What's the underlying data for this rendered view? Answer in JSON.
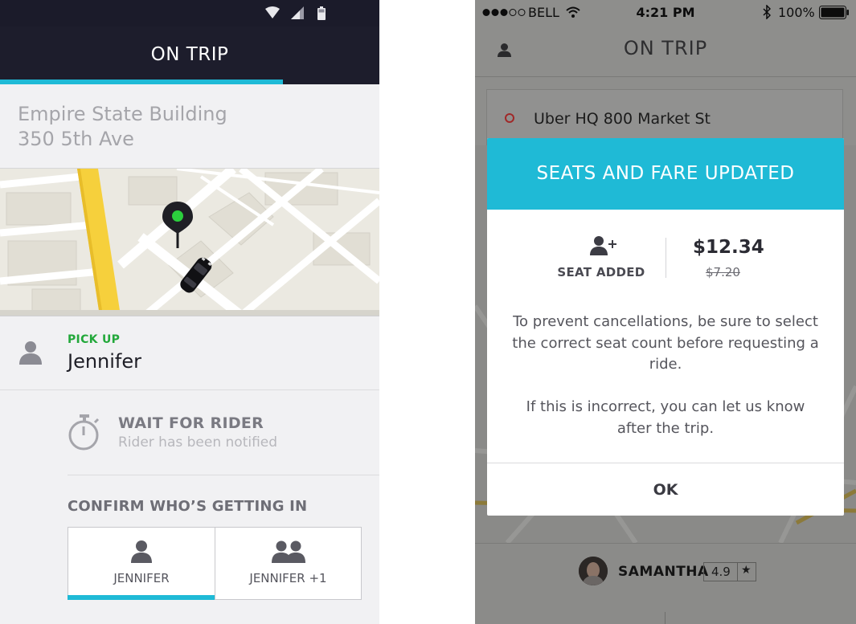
{
  "left_screen": {
    "header": {
      "title": "ON TRIP"
    },
    "trip_progress": 0.745,
    "destination": {
      "name": "Empire State Building",
      "street": "350 5th Ave"
    },
    "pickup": {
      "label": "PICK UP",
      "rider_name": "Jennifer"
    },
    "wait": {
      "title": "WAIT FOR RIDER",
      "subtitle": "Rider has been notified"
    },
    "confirm": {
      "label": "CONFIRM WHO’S GETTING IN",
      "options": [
        {
          "label": "JENNIFER",
          "icon": "person-icon",
          "selected": true
        },
        {
          "label": "JENNIFER +1",
          "icon": "two-people-icon",
          "selected": false
        }
      ]
    }
  },
  "right_screen": {
    "status_bar": {
      "carrier": "BELL",
      "time": "4:21 PM",
      "battery": "100%"
    },
    "header": {
      "title": "ON TRIP"
    },
    "destination": {
      "text": "Uber HQ 800 Market St"
    },
    "modal": {
      "title": "SEATS AND FARE UPDATED",
      "seat_label": "SEAT ADDED",
      "new_fare": "$12.34",
      "old_fare": "$7.20",
      "message_1": "To prevent cancellations, be sure to select the correct seat count before requesting a ride.",
      "message_2": "If this is incorrect, you can let us know after the trip.",
      "ok_label": "OK"
    },
    "driver": {
      "name": "SAMANTHA",
      "rating": "4.9",
      "star": "★"
    }
  },
  "colors": {
    "accent": "#1fbad6",
    "header_dark": "#1d1d2c",
    "pickup_green": "#22a83a",
    "map_road_yellow": "#f6d03c",
    "destination_red": "#a02828"
  }
}
